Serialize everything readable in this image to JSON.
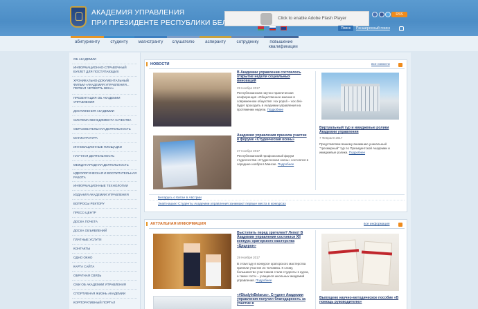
{
  "header": {
    "title_line1": "АКАДЕМИЯ УПРАВЛЕНИЯ",
    "title_line2": "ПРИ ПРЕЗИДЕНТЕ РЕСПУБЛИКИ БЕЛАРУСЬ",
    "flash_notice": "Click to enable Adobe Flash Player",
    "search_button": "Поиск",
    "advanced_search": "Расширенный поиск",
    "rss_label": "RSS"
  },
  "tabs": [
    "абитуриенту",
    "студенту",
    "магистранту",
    "слушателю",
    "аспиранту",
    "сотруднику",
    "повышение квалификации"
  ],
  "tab_colors": [
    "#e79626",
    "#3c8ccb",
    "#3d7fc0",
    "#7f9ec7",
    "#c9a23e",
    "#6a8bb8",
    "#46689a"
  ],
  "sidebar": [
    "ОБ АКАДЕМИИ",
    "ИНФОРМАЦИОННО-СПРАВОЧНЫЙ БУКЛЕТ ДЛЯ ПОСТУПАЮЩИХ",
    "ХРОНИКАЛЬНО-ДОКУМЕНТАЛЬНЫЙ ФИЛЬМ «АКАДЕМИЯ УПРАВЛЕНИЯ... ПЕРВАЯ ЧЕТВЕРТЬ ВЕКА»",
    "ПРЕЗЕНТАЦИЯ ОБ АКАДЕМИИ УПРАВЛЕНИЯ",
    "ДОСТИЖЕНИЯ АКАДЕМИИ",
    "СИСТЕМА МЕНЕДЖМЕНТА КАЧЕСТВА",
    "ОБРАЗОВАТЕЛЬНАЯ ДЕЯТЕЛЬНОСТЬ",
    "МАГИСТРАТУРА",
    "ИННОВАЦИОННЫЕ ПЛОЩАДКИ",
    "НАУЧНАЯ ДЕЯТЕЛЬНОСТЬ",
    "МЕЖДУНАРОДНАЯ ДЕЯТЕЛЬНОСТЬ",
    "ИДЕОЛОГИЧЕСКАЯ И ВОСПИТАТЕЛЬНАЯ РАБОТА",
    "ИНФОРМАЦИОННЫЕ ТЕХНОЛОГИИ",
    "ИЗДАНИЯ АКАДЕМИИ УПРАВЛЕНИЯ",
    "ВОПРОСЫ РЕКТОРУ",
    "ПРЕСС-ЦЕНТР",
    "ДОСКА ПОЧЕТА",
    "ДОСКА ОБЪЯВЛЕНИЙ",
    "ПЛАТНЫЕ УСЛУГИ",
    "КОНТАКТЫ",
    "ОДНО ОКНО",
    "КАРТА САЙТА",
    "ОБРАТНАЯ СВЯЗЬ",
    "СМИ ОБ АКАДЕМИИ УПРАВЛЕНИЯ",
    "СПОРТИВНАЯ ЖИЗНЬ АКАДЕМИИ",
    "КОРПОРАТИВНЫЙ ПОРТАЛ"
  ],
  "news": {
    "heading": "НОВОСТИ",
    "all_link": "все новости",
    "items": [
      {
        "title": "В Академии управления состоялось открытие недели социальных инноваций",
        "date": "29 Ноября 2017",
        "text": "Республиканская научно-практическая конференция «Общественное мнение в современном обществе: vox populi – vox dei» будет проходить в Академии управления на протяжении недели.",
        "more": "Подробнее"
      },
      {
        "title": "Академия управления приняла участие в форуме «Студенческая осень»",
        "date": "27 Ноября 2017",
        "text": "Республиканский профсоюзный форум студенчества «Студенческая осень» состоялся в середине ноября в Минске.",
        "more": "Подробнее"
      },
      {
        "title": "Виртуальный тур и имиджевые ролики Академии управления",
        "date": "7 Февраля 2017",
        "text": "Представляем вашему вниманию уникальный \"трехмерный\" тур по Президентской Академии и имиджевые ролики.",
        "more": "Подробнее"
      }
    ],
    "links": [
      "Беларусь о Китае в Австрии",
      "Знай наших! Студенты Академии управления занимают первые места в конкурсах"
    ]
  },
  "actual": {
    "heading": "АКТУАЛЬНАЯ ИНФОРМАЦИЯ",
    "all_link": "все информация",
    "items": [
      {
        "title": "Выступить перед зрителем? Легко! В Академии управления состоялся XII конкурс ораторского мастерства «Цицерон»",
        "date": "29 Ноября 2017",
        "text": "В этом году в конкурсе ораторского мастерства приняли участие 24 человека. К слову, большинство участников стали студенты 1 курса, а также гости – учащиеся школьных академий управления.",
        "more": "Подробнее"
      },
      {
        "title": "«#StudyInBelarus». Студент Академии управления получил благодарность за участие в",
        "date": "",
        "text": "",
        "more": ""
      },
      {
        "title": "Выпущено научно-методическое пособие «В помощь руководителю»",
        "date": "",
        "text": "",
        "more": ""
      }
    ]
  }
}
